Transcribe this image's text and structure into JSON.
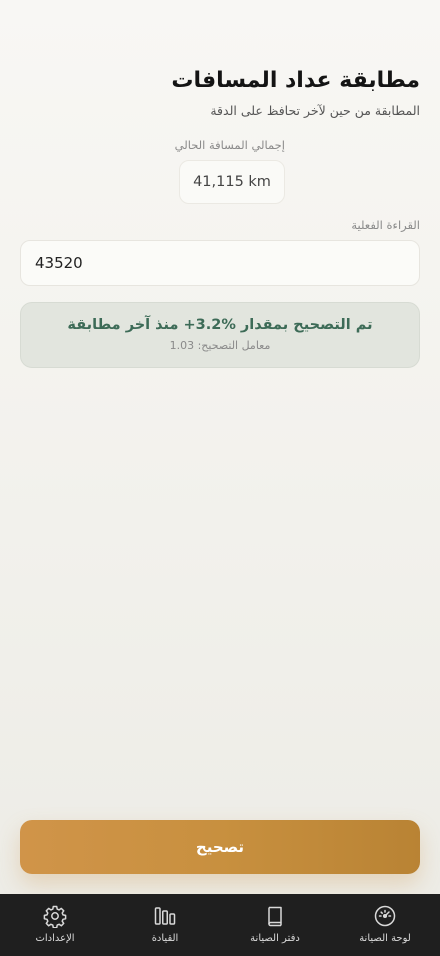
{
  "header": {
    "title": "مطابقة عداد المسافات",
    "subtitle": "المطابقة من حين لآخر تحافظ على الدقة"
  },
  "current_distance": {
    "label": "إجمالي المسافة الحالي",
    "value": "41,115 km"
  },
  "actual_reading": {
    "label": "القراءة الفعلية",
    "value": "43520"
  },
  "result": {
    "main": "تم التصحيح بمقدار ‎+3.2%‎ منذ آخر مطابقة",
    "factor": "معامل التصحيح: 1.03"
  },
  "actions": {
    "correct_label": "تصحيح"
  },
  "tabbar": {
    "items": [
      {
        "label": "لوحة الصيانة",
        "icon": "gauge-icon"
      },
      {
        "label": "دفتر الصيانة",
        "icon": "book-icon"
      },
      {
        "label": "القيادة",
        "icon": "bars-icon"
      },
      {
        "label": "الإعدادات",
        "icon": "gear-icon"
      }
    ]
  },
  "colors": {
    "accent": "#c8903f",
    "result_text": "#3d6b57",
    "tabbar_bg": "#1f1f1f"
  }
}
